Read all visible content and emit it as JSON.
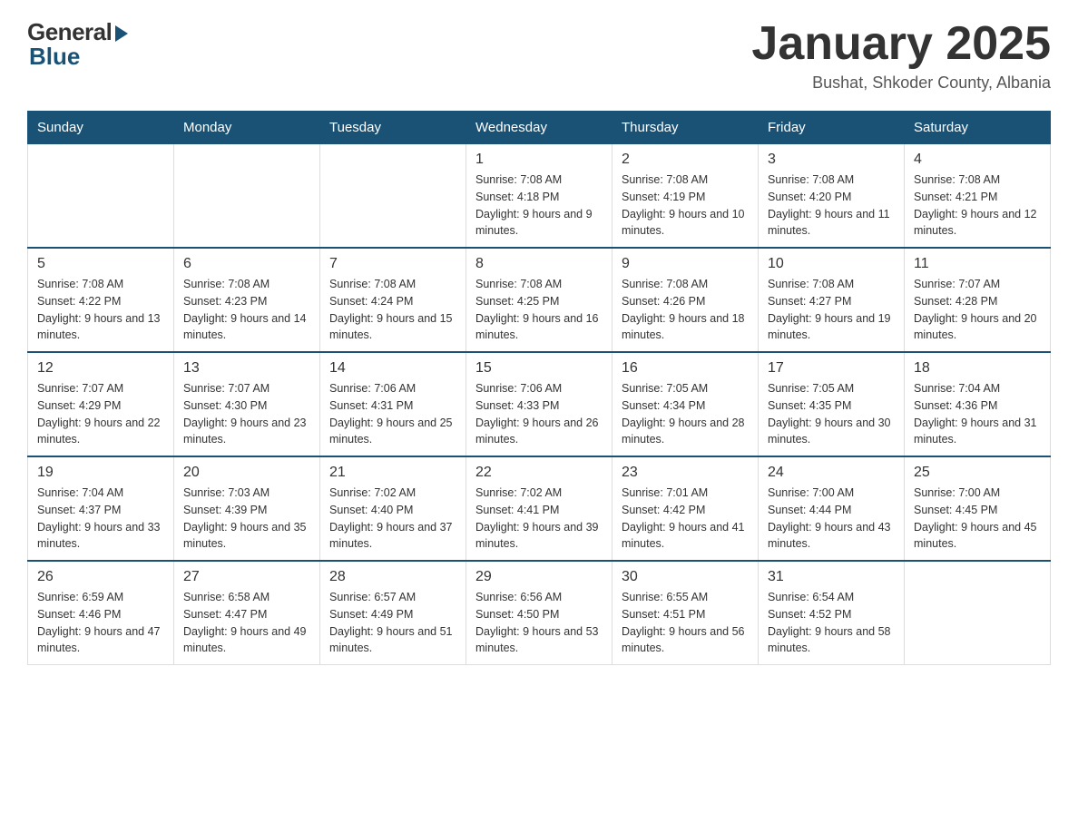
{
  "logo": {
    "general": "General",
    "blue": "Blue"
  },
  "title": "January 2025",
  "subtitle": "Bushat, Shkoder County, Albania",
  "days_header": [
    "Sunday",
    "Monday",
    "Tuesday",
    "Wednesday",
    "Thursday",
    "Friday",
    "Saturday"
  ],
  "weeks": [
    [
      {
        "day": "",
        "info": ""
      },
      {
        "day": "",
        "info": ""
      },
      {
        "day": "",
        "info": ""
      },
      {
        "day": "1",
        "info": "Sunrise: 7:08 AM\nSunset: 4:18 PM\nDaylight: 9 hours and 9 minutes."
      },
      {
        "day": "2",
        "info": "Sunrise: 7:08 AM\nSunset: 4:19 PM\nDaylight: 9 hours and 10 minutes."
      },
      {
        "day": "3",
        "info": "Sunrise: 7:08 AM\nSunset: 4:20 PM\nDaylight: 9 hours and 11 minutes."
      },
      {
        "day": "4",
        "info": "Sunrise: 7:08 AM\nSunset: 4:21 PM\nDaylight: 9 hours and 12 minutes."
      }
    ],
    [
      {
        "day": "5",
        "info": "Sunrise: 7:08 AM\nSunset: 4:22 PM\nDaylight: 9 hours and 13 minutes."
      },
      {
        "day": "6",
        "info": "Sunrise: 7:08 AM\nSunset: 4:23 PM\nDaylight: 9 hours and 14 minutes."
      },
      {
        "day": "7",
        "info": "Sunrise: 7:08 AM\nSunset: 4:24 PM\nDaylight: 9 hours and 15 minutes."
      },
      {
        "day": "8",
        "info": "Sunrise: 7:08 AM\nSunset: 4:25 PM\nDaylight: 9 hours and 16 minutes."
      },
      {
        "day": "9",
        "info": "Sunrise: 7:08 AM\nSunset: 4:26 PM\nDaylight: 9 hours and 18 minutes."
      },
      {
        "day": "10",
        "info": "Sunrise: 7:08 AM\nSunset: 4:27 PM\nDaylight: 9 hours and 19 minutes."
      },
      {
        "day": "11",
        "info": "Sunrise: 7:07 AM\nSunset: 4:28 PM\nDaylight: 9 hours and 20 minutes."
      }
    ],
    [
      {
        "day": "12",
        "info": "Sunrise: 7:07 AM\nSunset: 4:29 PM\nDaylight: 9 hours and 22 minutes."
      },
      {
        "day": "13",
        "info": "Sunrise: 7:07 AM\nSunset: 4:30 PM\nDaylight: 9 hours and 23 minutes."
      },
      {
        "day": "14",
        "info": "Sunrise: 7:06 AM\nSunset: 4:31 PM\nDaylight: 9 hours and 25 minutes."
      },
      {
        "day": "15",
        "info": "Sunrise: 7:06 AM\nSunset: 4:33 PM\nDaylight: 9 hours and 26 minutes."
      },
      {
        "day": "16",
        "info": "Sunrise: 7:05 AM\nSunset: 4:34 PM\nDaylight: 9 hours and 28 minutes."
      },
      {
        "day": "17",
        "info": "Sunrise: 7:05 AM\nSunset: 4:35 PM\nDaylight: 9 hours and 30 minutes."
      },
      {
        "day": "18",
        "info": "Sunrise: 7:04 AM\nSunset: 4:36 PM\nDaylight: 9 hours and 31 minutes."
      }
    ],
    [
      {
        "day": "19",
        "info": "Sunrise: 7:04 AM\nSunset: 4:37 PM\nDaylight: 9 hours and 33 minutes."
      },
      {
        "day": "20",
        "info": "Sunrise: 7:03 AM\nSunset: 4:39 PM\nDaylight: 9 hours and 35 minutes."
      },
      {
        "day": "21",
        "info": "Sunrise: 7:02 AM\nSunset: 4:40 PM\nDaylight: 9 hours and 37 minutes."
      },
      {
        "day": "22",
        "info": "Sunrise: 7:02 AM\nSunset: 4:41 PM\nDaylight: 9 hours and 39 minutes."
      },
      {
        "day": "23",
        "info": "Sunrise: 7:01 AM\nSunset: 4:42 PM\nDaylight: 9 hours and 41 minutes."
      },
      {
        "day": "24",
        "info": "Sunrise: 7:00 AM\nSunset: 4:44 PM\nDaylight: 9 hours and 43 minutes."
      },
      {
        "day": "25",
        "info": "Sunrise: 7:00 AM\nSunset: 4:45 PM\nDaylight: 9 hours and 45 minutes."
      }
    ],
    [
      {
        "day": "26",
        "info": "Sunrise: 6:59 AM\nSunset: 4:46 PM\nDaylight: 9 hours and 47 minutes."
      },
      {
        "day": "27",
        "info": "Sunrise: 6:58 AM\nSunset: 4:47 PM\nDaylight: 9 hours and 49 minutes."
      },
      {
        "day": "28",
        "info": "Sunrise: 6:57 AM\nSunset: 4:49 PM\nDaylight: 9 hours and 51 minutes."
      },
      {
        "day": "29",
        "info": "Sunrise: 6:56 AM\nSunset: 4:50 PM\nDaylight: 9 hours and 53 minutes."
      },
      {
        "day": "30",
        "info": "Sunrise: 6:55 AM\nSunset: 4:51 PM\nDaylight: 9 hours and 56 minutes."
      },
      {
        "day": "31",
        "info": "Sunrise: 6:54 AM\nSunset: 4:52 PM\nDaylight: 9 hours and 58 minutes."
      },
      {
        "day": "",
        "info": ""
      }
    ]
  ]
}
